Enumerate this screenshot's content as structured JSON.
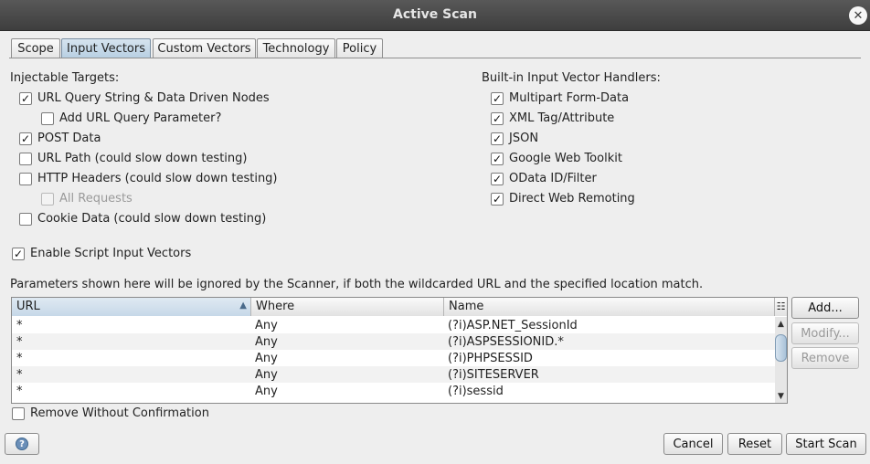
{
  "window": {
    "title": "Active Scan"
  },
  "tabs": [
    {
      "label": "Scope"
    },
    {
      "label": "Input Vectors",
      "active": true
    },
    {
      "label": "Custom Vectors"
    },
    {
      "label": "Technology"
    },
    {
      "label": "Policy"
    }
  ],
  "injectable": {
    "heading": "Injectable Targets:",
    "options": [
      {
        "label": "URL Query String & Data Driven Nodes",
        "checked": true
      },
      {
        "label": "Add URL Query Parameter?",
        "checked": false
      },
      {
        "label": "POST Data",
        "checked": true
      },
      {
        "label": "URL Path (could slow down testing)",
        "checked": false
      },
      {
        "label": "HTTP Headers (could slow down testing)",
        "checked": false
      },
      {
        "label": "All Requests",
        "checked": false,
        "disabled": true
      },
      {
        "label": "Cookie Data (could slow down testing)",
        "checked": false
      }
    ]
  },
  "handlers": {
    "heading": "Built-in Input Vector Handlers:",
    "options": [
      {
        "label": "Multipart Form-Data",
        "checked": true
      },
      {
        "label": "XML Tag/Attribute",
        "checked": true
      },
      {
        "label": "JSON",
        "checked": true
      },
      {
        "label": "Google Web Toolkit",
        "checked": true
      },
      {
        "label": "OData ID/Filter",
        "checked": true
      },
      {
        "label": "Direct Web Remoting",
        "checked": true
      }
    ]
  },
  "script_vectors": {
    "label": "Enable Script Input Vectors",
    "checked": true
  },
  "params": {
    "description": "Parameters shown here will be ignored by the Scanner, if both the wildcarded URL and the specified location match.",
    "columns": [
      "URL",
      "Where",
      "Name"
    ],
    "rows": [
      [
        "*",
        "Any",
        "(?i)ASP.NET_SessionId"
      ],
      [
        "*",
        "Any",
        "(?i)ASPSESSIONID.*"
      ],
      [
        "*",
        "Any",
        "(?i)PHPSESSID"
      ],
      [
        "*",
        "Any",
        "(?i)SITESERVER"
      ],
      [
        "*",
        "Any",
        "(?i)sessid"
      ]
    ]
  },
  "side_buttons": {
    "add": "Add...",
    "modify": "Modify...",
    "remove": "Remove"
  },
  "remove_confirm": {
    "label": "Remove Without Confirmation",
    "checked": false
  },
  "footer": {
    "cancel": "Cancel",
    "reset": "Reset",
    "start": "Start Scan"
  },
  "icons": {
    "close": "close-icon",
    "help": "help-icon"
  },
  "colors": {
    "titlebar": "#4a4a4a",
    "active_tab": "#c6d8e8",
    "scroll_thumb": "#a9c2d9"
  }
}
